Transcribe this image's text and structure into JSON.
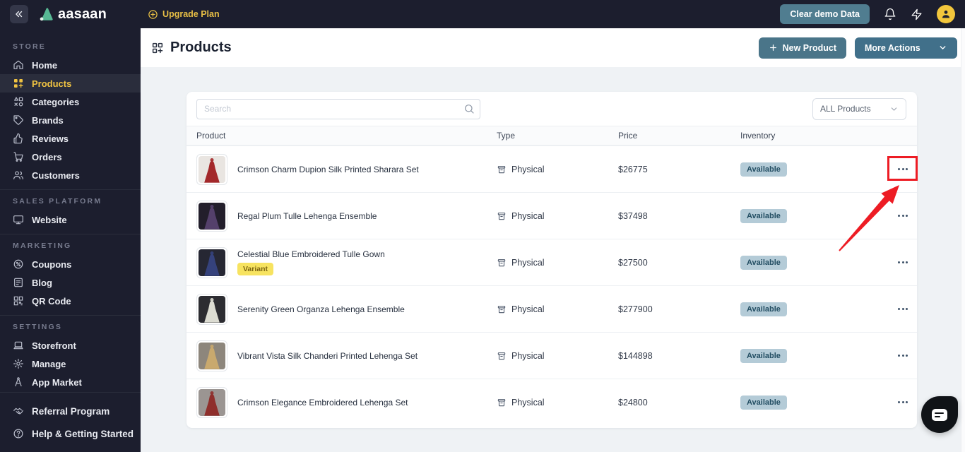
{
  "topbar": {
    "brand": "aasaan",
    "upgrade_label": "Upgrade Plan",
    "clear_demo_label": "Clear demo Data"
  },
  "sidebar": {
    "sections": {
      "store": "STORE",
      "sales": "SALES PLATFORM",
      "marketing": "MARKETING",
      "settings": "SETTINGS"
    },
    "items": {
      "home": "Home",
      "products": "Products",
      "categories": "Categories",
      "brands": "Brands",
      "reviews": "Reviews",
      "orders": "Orders",
      "customers": "Customers",
      "website": "Website",
      "coupons": "Coupons",
      "blog": "Blog",
      "qr": "QR Code",
      "storefront": "Storefront",
      "manage": "Manage",
      "app_market": "App Market",
      "referral": "Referral Program",
      "help": "Help & Getting Started"
    }
  },
  "header": {
    "title": "Products",
    "new_product_label": "New Product",
    "more_actions_label": "More Actions"
  },
  "toolbar": {
    "search_placeholder": "Search",
    "filter_value": "ALL Products"
  },
  "table": {
    "columns": {
      "product": "Product",
      "type": "Type",
      "price": "Price",
      "inventory": "Inventory"
    },
    "rows": [
      {
        "name": "Crimson Charm Dupion Silk Printed Sharara Set",
        "type": "Physical",
        "price": "$26775",
        "inventory": "Available",
        "thumb_style": "--tbg:#e9e5e1;--dress:#a3282a"
      },
      {
        "name": "Regal Plum Tulle Lehenga Ensemble",
        "type": "Physical",
        "price": "$37498",
        "inventory": "Available",
        "thumb_style": "--tbg:#221e2b;--dress:#54406b"
      },
      {
        "name": "Celestial Blue Embroidered Tulle Gown",
        "variant_label": "Variant",
        "type": "Physical",
        "price": "$27500",
        "inventory": "Available",
        "thumb_style": "--tbg:#262733;--dress:#35427c"
      },
      {
        "name": "Serenity Green Organza Lehenga Ensemble",
        "type": "Physical",
        "price": "$277900",
        "inventory": "Available",
        "thumb_style": "--tbg:#2c2c31;--dress:#dcdcd2"
      },
      {
        "name": "Vibrant Vista Silk Chanderi Printed Lehenga Set",
        "type": "Physical",
        "price": "$144898",
        "inventory": "Available",
        "thumb_style": "--tbg:#8d867c;--dress:#c9a96e"
      },
      {
        "name": "Crimson Elegance Embroidered Lehenga Set",
        "type": "Physical",
        "price": "$24800",
        "inventory": "Available",
        "thumb_style": "--tbg:#9b9592;--dress:#8f2f2c"
      }
    ]
  },
  "colors": {
    "topbar_bg": "#1c1e2e",
    "accent_yellow": "#f0c342",
    "teal_button": "#4a7589",
    "available_badge_bg": "#b4cbd7",
    "available_badge_text": "#234e63",
    "variant_badge_bg": "#f7e360",
    "annotation_red": "#ed1c24"
  }
}
